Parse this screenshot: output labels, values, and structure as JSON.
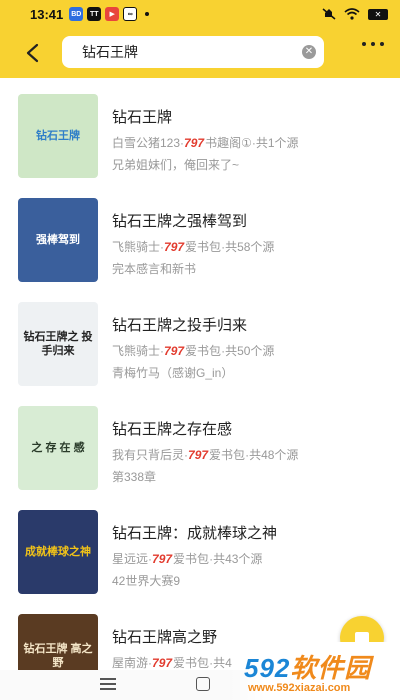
{
  "status_bar": {
    "time": "13:41",
    "apps": [
      "BD",
      "TT",
      "▶",
      "∞"
    ],
    "battery": "✕"
  },
  "search": {
    "value": "钻石王牌",
    "clear_icon": "clear-icon"
  },
  "results": [
    {
      "title": "钻石王牌",
      "author": "白雪公猪123",
      "source_mark": "797",
      "source": "书趣阁①",
      "count": "共1个源",
      "latest": "兄弟姐妹们，俺回来了~",
      "cover": {
        "bg": "#cfe7c6",
        "text": "钻石王牌",
        "accent": "#2e7ec8"
      }
    },
    {
      "title": "钻石王牌之强棒驾到",
      "author": "飞熊骑士",
      "source_mark": "797",
      "source": "爱书包",
      "count": "共58个源",
      "latest": "完本感言和新书",
      "cover": {
        "bg": "#3a5f9c",
        "text": "强棒驾到",
        "accent": "#ffffff"
      }
    },
    {
      "title": "钻石王牌之投手归来",
      "author": "飞熊骑士",
      "source_mark": "797",
      "source": "爱书包",
      "count": "共50个源",
      "latest": "青梅竹马（感谢G_in）",
      "cover": {
        "bg": "#eef1f3",
        "text": "钻石王牌之 投手归来",
        "accent": "#222222"
      }
    },
    {
      "title": "钻石王牌之存在感",
      "author": "我有只背后灵",
      "source_mark": "797",
      "source": "爱书包",
      "count": "共48个源",
      "latest": "第338章",
      "cover": {
        "bg": "#d8ecd4",
        "text": "之 存 在 感",
        "accent": "#2a3b2a"
      }
    },
    {
      "title": "钻石王牌：成就棒球之神",
      "author": "星远远",
      "source_mark": "797",
      "source": "爱书包",
      "count": "共43个源",
      "latest": "42世界大赛9",
      "cover": {
        "bg": "#2a3a6a",
        "text": "成就棒球之神",
        "accent": "#f2c318"
      }
    },
    {
      "title": "钻石王牌高之野",
      "author": "屋南游",
      "source_mark": "797",
      "source": "爱书包",
      "count": "共4",
      "latest": "",
      "cover": {
        "bg": "#5a3b22",
        "text": "钻石王牌 高之野",
        "accent": "#f5e6c8"
      }
    }
  ],
  "separator": "·",
  "watermark": {
    "digits": "592",
    "text": "软件园",
    "url": "www.592xiazai.com"
  },
  "colors": {
    "header": "#f8d231",
    "meta_text": "#999999",
    "source_mark": "#e23b2e"
  }
}
